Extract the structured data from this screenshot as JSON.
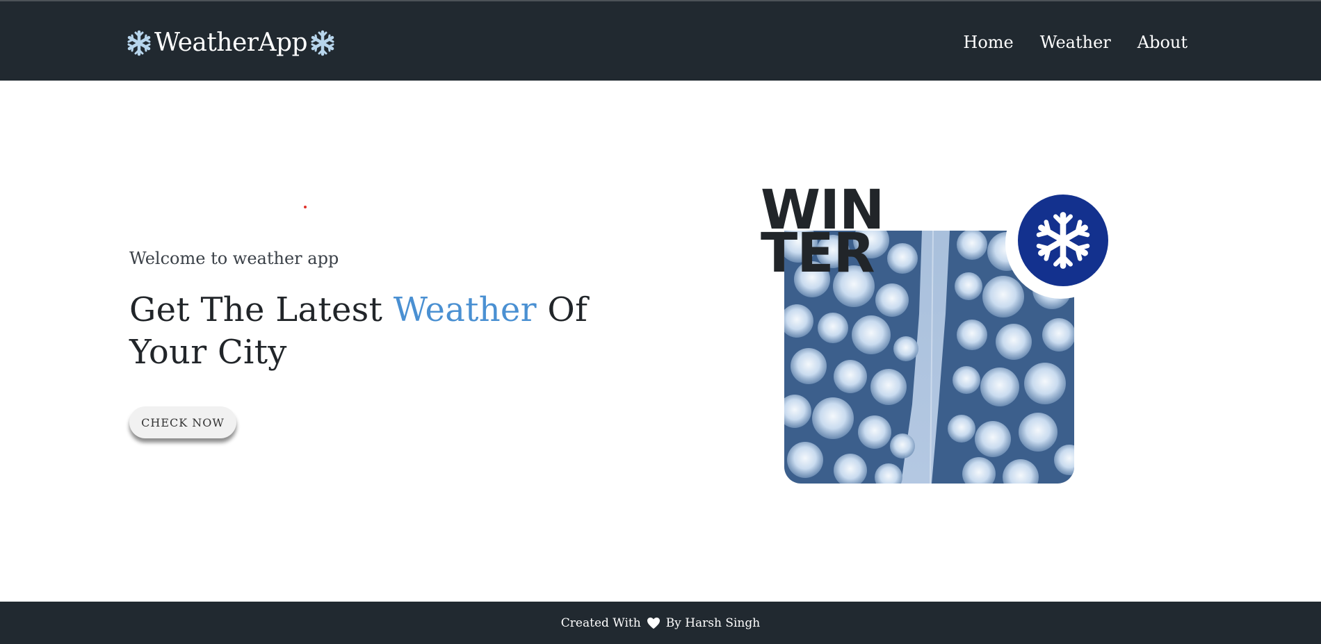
{
  "navbar": {
    "brand": "WeatherApp",
    "brand_icon": "snowflake-icon",
    "links": [
      "Home",
      "Weather",
      "About"
    ]
  },
  "hero": {
    "welcome": "Welcome to weather app",
    "headline_before": "Get The Latest ",
    "headline_accent": "Weather",
    "headline_after": " Of Your City",
    "button_label": "CHECK NOW",
    "accent_color": "#4a90d2"
  },
  "graphic": {
    "line1": "WIN",
    "line2": "TER",
    "badge_icon": "snowflake-icon",
    "badge_color": "#13318e",
    "photo": "snowy-forest-road-aerial"
  },
  "footer": {
    "before_heart": "Created With",
    "heart_icon": "heart-icon",
    "after_heart": "By Harsh Singh"
  },
  "colors": {
    "navbar_bg": "#212930",
    "text_dark": "#212529"
  }
}
